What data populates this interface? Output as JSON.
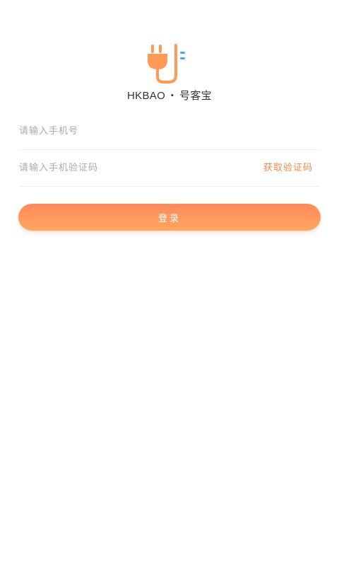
{
  "brand": {
    "name_en": "HKBAO",
    "separator": "·",
    "name_cn": "号客宝",
    "logo_icon": "plug-icon"
  },
  "colors": {
    "accent": "#f08a4b",
    "logo_orange": "#ff9a55",
    "logo_blue": "#39b6e0",
    "button_top": "#ff8a5c",
    "button_bottom": "#ffa65e"
  },
  "form": {
    "phone_placeholder": "请输入手机号",
    "code_placeholder": "请输入手机验证码",
    "get_code_label": "获取验证码",
    "login_label": "登录"
  }
}
